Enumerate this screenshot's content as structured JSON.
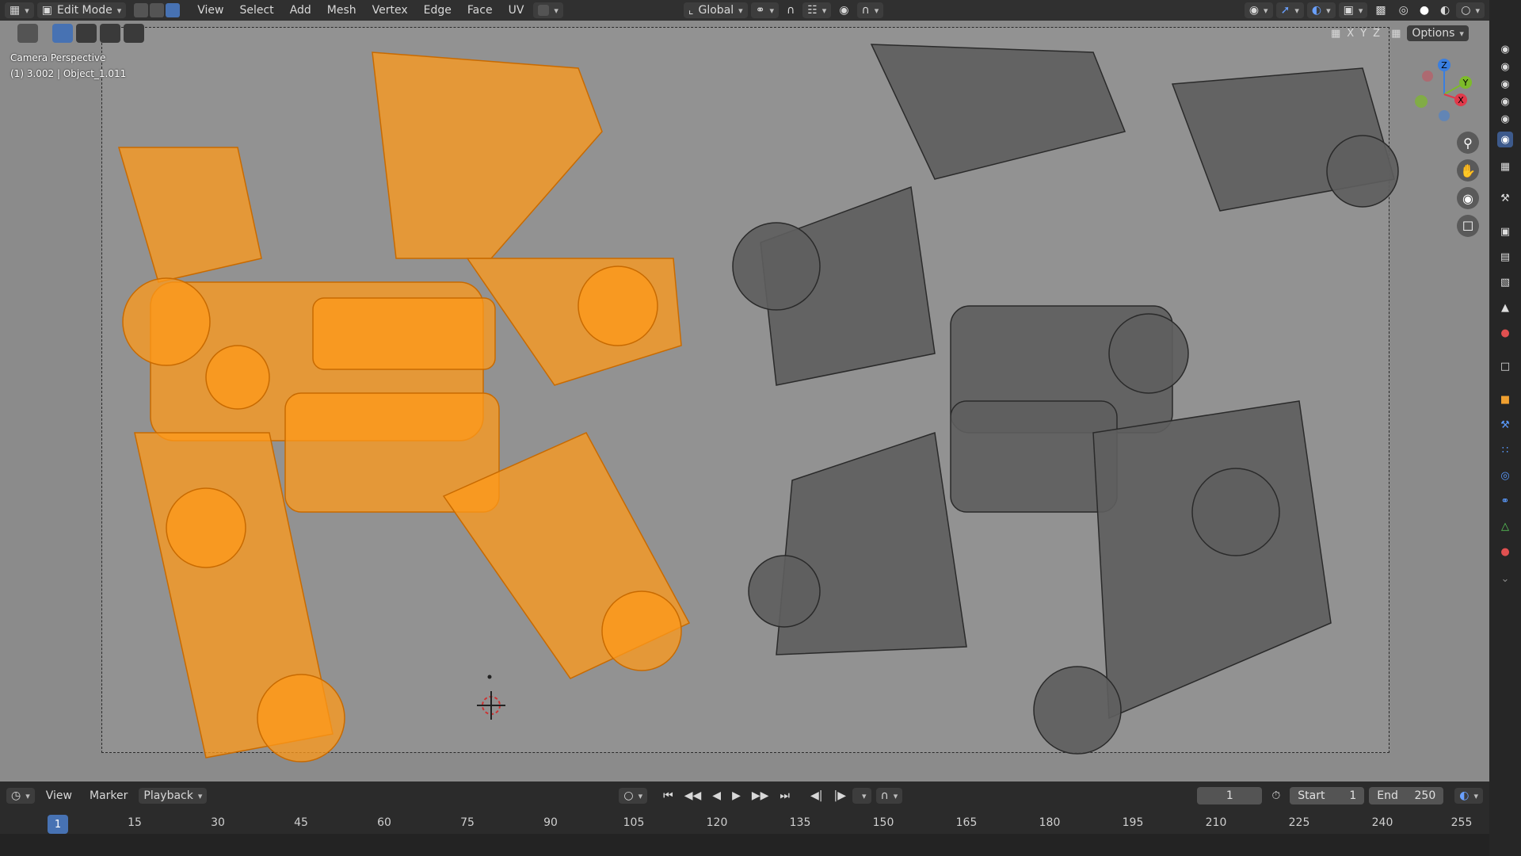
{
  "header": {
    "mode": "Edit Mode",
    "menus": [
      "View",
      "Select",
      "Add",
      "Mesh",
      "Vertex",
      "Edge",
      "Face",
      "UV"
    ],
    "transform_orientation": "Global"
  },
  "viewport": {
    "camera_label": "Camera Perspective",
    "object_label": "(1) 3.002 | Object_1.011",
    "axes": [
      "X",
      "Y",
      "Z"
    ],
    "options_label": "Options",
    "gizmo_axes": {
      "z": "Z",
      "y": "Y",
      "x": "X"
    }
  },
  "timeline": {
    "menus": [
      "View",
      "Marker"
    ],
    "playback_label": "Playback",
    "current_frame": "1",
    "start_label": "Start",
    "start_value": "1",
    "end_label": "End",
    "end_value": "250",
    "ruler_current": "1",
    "ruler_ticks": [
      "15",
      "30",
      "45",
      "60",
      "75",
      "90",
      "105",
      "120",
      "135",
      "150",
      "165",
      "180",
      "195",
      "210",
      "225",
      "240",
      "255"
    ]
  },
  "colors": {
    "selected_mesh": "#ff9a1a",
    "unselected_mesh": "#5e5e5e",
    "accent": "#4772b3",
    "axis_x": "#e0394a",
    "axis_y": "#7dbb2a",
    "axis_z": "#3a7fe0"
  }
}
